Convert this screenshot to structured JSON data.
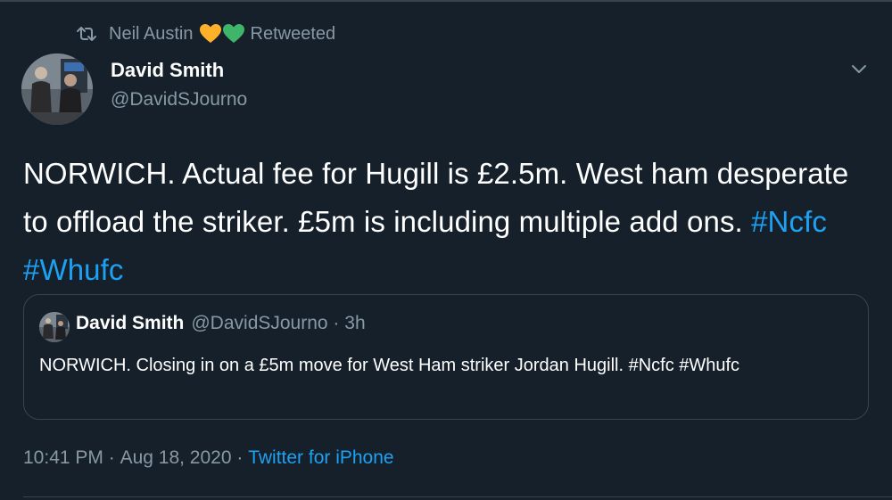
{
  "retweet": {
    "user": "Neil Austin",
    "label": "Retweeted",
    "icon": "retweet-icon",
    "emoji": [
      "yellow-heart",
      "green-heart"
    ],
    "emoji_colors": [
      "#ffb229",
      "#3fb56a"
    ]
  },
  "tweet": {
    "name": "David Smith",
    "handle": "@DavidSJourno",
    "text_parts": [
      "NORWICH. Actual fee for Hugill is £2.5m. West ham desperate to offload the striker. £5m is including multiple add ons. ",
      "#Ncfc",
      " ",
      "#Whufc"
    ]
  },
  "quote": {
    "name": "David Smith",
    "handle": "@DavidSJourno",
    "separator": " · ",
    "time": "3h",
    "text": "NORWICH. Closing in on a £5m move for West Ham striker Jordan Hugill. #Ncfc #Whufc"
  },
  "footer": {
    "time": "10:41 PM",
    "separator1": " · ",
    "date": "Aug 18, 2020",
    "separator2": " · ",
    "source": "Twitter for iPhone"
  },
  "colors": {
    "background": "#15202b",
    "secondary_text": "#8899a6",
    "link": "#1da1f2",
    "border": "#38444d"
  }
}
